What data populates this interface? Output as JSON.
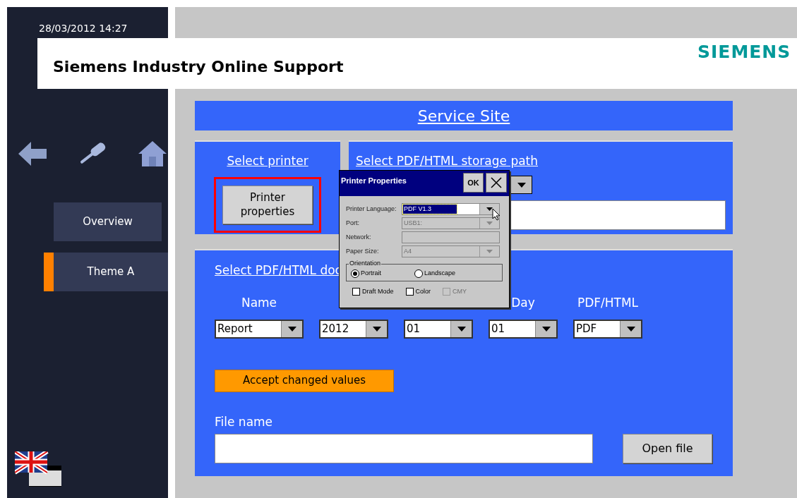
{
  "datetime": "28/03/2012 14:27",
  "header": {
    "title": "Siemens Industry Online Support",
    "logo": "SIEMENS"
  },
  "sidebar": {
    "items": [
      {
        "label": "Overview",
        "selected": false
      },
      {
        "label": "Theme A",
        "selected": true
      }
    ]
  },
  "service_site": {
    "title": "Service Site",
    "select_printer": {
      "title": "Select printer",
      "button": "Printer properties",
      "highlighted": true
    },
    "storage_path": {
      "title": "Select PDF/HTML storage path"
    },
    "documents": {
      "title": "Select PDF/HTML doc",
      "columns": [
        {
          "label": "Name",
          "value": "Report"
        },
        {
          "value": "2012"
        },
        {
          "value": "01"
        },
        {
          "label": "Day",
          "value": "01"
        },
        {
          "label": "PDF/HTML",
          "value": "PDF"
        }
      ],
      "accept_button": "Accept changed values",
      "file_name_label": "File name",
      "open_button": "Open file"
    }
  },
  "dialog": {
    "title": "Printer Properties",
    "ok": "OK",
    "fields": [
      {
        "label": "Printer Language:",
        "value": "PDF V1.3",
        "kind": "dropdown",
        "disabled": false
      },
      {
        "label": "Port:",
        "value": "USB1:",
        "kind": "dropdown",
        "disabled": true
      },
      {
        "label": "Network:",
        "kind": "text",
        "disabled": true
      },
      {
        "label": "Paper Size:",
        "value": "A4",
        "kind": "dropdown",
        "disabled": true
      }
    ],
    "orientation": {
      "title": "Orientation",
      "options": [
        {
          "label": "Portrait",
          "selected": true
        },
        {
          "label": "Landscape",
          "selected": false
        }
      ]
    },
    "checkboxes": [
      {
        "label": "Draft Mode",
        "checked": false,
        "disabled": false
      },
      {
        "label": "Color",
        "checked": false,
        "disabled": false
      },
      {
        "label": "CMY",
        "checked": false,
        "disabled": true
      }
    ]
  }
}
